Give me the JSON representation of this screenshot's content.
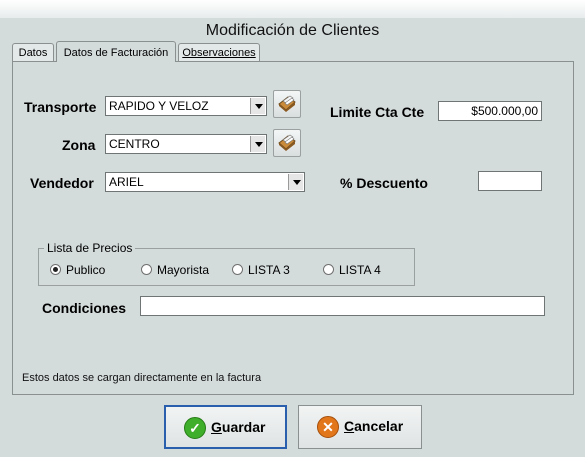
{
  "window": {
    "title": "Modificación de Clientes"
  },
  "tabs": [
    {
      "label": "Datos",
      "active": false
    },
    {
      "label": "Datos de Facturación",
      "active": true
    },
    {
      "label": "Observaciones",
      "active": false
    }
  ],
  "form": {
    "transporte": {
      "label": "Transporte",
      "value": "RAPIDO Y VELOZ"
    },
    "zona": {
      "label": "Zona",
      "value": "CENTRO"
    },
    "vendedor": {
      "label": "Vendedor",
      "value": "ARIEL"
    },
    "limite": {
      "label": "Limite Cta Cte",
      "value": "$500.000,00"
    },
    "descuento": {
      "label": "% Descuento",
      "value": ""
    },
    "condiciones": {
      "label": "Condiciones",
      "value": ""
    }
  },
  "lista_precios": {
    "legend": "Lista de Precios",
    "options": [
      "Publico",
      "Mayorista",
      "LISTA 3",
      "LISTA 4"
    ],
    "selected": "Publico"
  },
  "note": "Estos datos se cargan directamente en la factura",
  "buttons": {
    "guardar_first": "G",
    "guardar_rest": "uardar",
    "cancelar_first": "C",
    "cancelar_rest": "ancelar"
  },
  "colors": {
    "guardar_icon": "#3fae2a",
    "cancelar_icon": "#e2761b",
    "focus_border": "#2a5fae"
  },
  "icons": {
    "lookup": "card-file-icon",
    "ok": "check-circle-icon",
    "cancel": "x-circle-icon"
  }
}
